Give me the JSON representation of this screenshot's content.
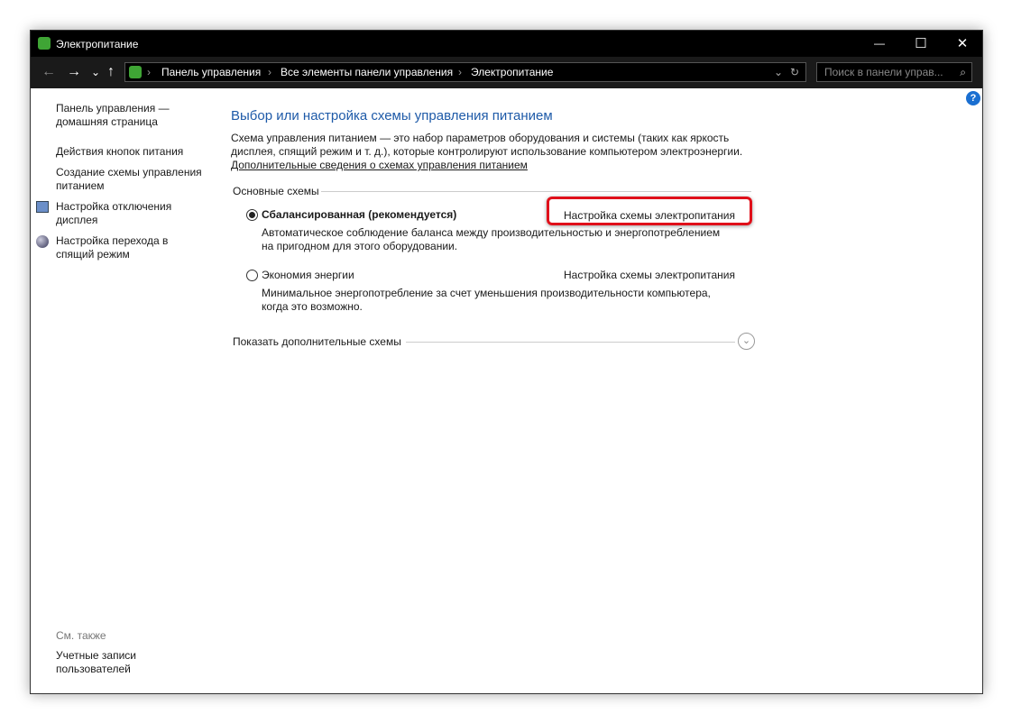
{
  "window": {
    "title": "Электропитание",
    "minimize": "—",
    "maximize": "☐",
    "close": "✕"
  },
  "address": {
    "back": "←",
    "forward": "→",
    "recent": "⌄",
    "up": "↑",
    "crumbs": [
      "Панель управления",
      "Все элементы панели управления",
      "Электропитание"
    ],
    "sep": "›",
    "dropdown": "⌄",
    "refresh": "↻",
    "search_placeholder": "Поиск в панели управ...",
    "search_icon": "⌕"
  },
  "sidebar": {
    "items": [
      "Панель управления —",
      "домашняя страница",
      "Действия кнопок питания",
      "Создание схемы управления",
      "питанием",
      "Настройка отключения",
      "дисплея",
      "Настройка перехода в",
      "спящий режим"
    ],
    "see_also": "См. также",
    "see_items": [
      "Учетные записи",
      "пользователей"
    ]
  },
  "help": "?",
  "main": {
    "title": "Выбор или настройка схемы управления питанием",
    "desc": [
      "Схема управления питанием — это набор параметров оборудования и системы (таких как яркость",
      "дисплея, спящий режим и т. д.), которые контролируют использование компьютером электроэнергии."
    ],
    "more_link": "Дополнительные сведения о схемах управления питанием",
    "group": "Основные схемы",
    "plans": [
      {
        "name": "Сбалансированная (рекомендуется)",
        "selected": true,
        "link": "Настройка схемы электропитания",
        "desc": [
          "Автоматическое соблюдение баланса между производительностью и энергопотреблением",
          "на пригодном для этого оборудовании."
        ]
      },
      {
        "name": "Экономия энергии",
        "selected": false,
        "link": "Настройка схемы электропитания",
        "desc": [
          "Минимальное энергопотребление за счет уменьшения производительности компьютера,",
          "когда это возможно."
        ]
      }
    ],
    "show_more": "Показать дополнительные схемы"
  }
}
